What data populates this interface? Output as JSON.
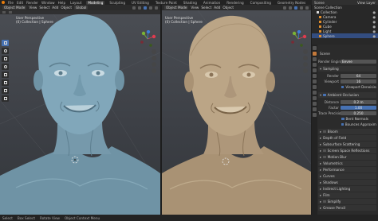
{
  "topbar": {
    "menus": [
      "File",
      "Edit",
      "Render",
      "Window",
      "Help"
    ],
    "tabs": [
      "Layout",
      "Modeling",
      "Sculpting",
      "UV Editing",
      "Texture Paint",
      "Shading",
      "Animation",
      "Rendering",
      "Compositing",
      "Geometry Nodes",
      "Scripting"
    ],
    "active_tab": "Modeling",
    "scene": "Scene",
    "view_layer": "View Layer"
  },
  "viewport_left": {
    "mode": "Object Mode",
    "menus": [
      "View",
      "Select",
      "Add",
      "Object"
    ],
    "orientation": "Global",
    "label_line1": "User Perspective",
    "label_line2": "(0) Collection | Sphere",
    "shading_color": "#7ea3b6"
  },
  "viewport_right": {
    "mode": "Object Mode",
    "menus": [
      "View",
      "Select",
      "Add",
      "Object"
    ],
    "label_line1": "User Perspective",
    "label_line2": "(0) Collection | Sphere",
    "shading_color": "#bda888"
  },
  "outliner": {
    "title": "Scene Collection",
    "items": [
      {
        "name": "Collection",
        "selected": false
      },
      {
        "name": "Camera",
        "selected": false
      },
      {
        "name": "Cylinder",
        "selected": false
      },
      {
        "name": "Cube",
        "selected": false
      },
      {
        "name": "Light",
        "selected": false
      },
      {
        "name": "Sphere",
        "selected": true
      }
    ]
  },
  "properties": {
    "scene_label": "Scene",
    "render_engine_label": "Render Engine",
    "render_engine": "Eevee",
    "sampling_title": "Sampling",
    "render_label": "Render",
    "render_value": "64",
    "viewport_label": "Viewport",
    "viewport_value": "16",
    "viewport_denoise": "Viewport Denoising",
    "ao_title": "Ambient Occlusion",
    "distance_label": "Distance",
    "distance_value": "0.2 m",
    "factor_label": "Factor",
    "factor_value": "1.00",
    "trace_label": "Trace Precision",
    "trace_value": "0.250",
    "bent_normals": "Bent Normals",
    "bounce_approx": "Bounces Approximation",
    "panels": [
      "Bloom",
      "Depth of Field",
      "Subsurface Scattering",
      "Screen Space Reflections",
      "Motion Blur",
      "Volumetrics",
      "Performance",
      "Curves",
      "Shadows",
      "Indirect Lighting",
      "Film",
      "Simplify",
      "Grease Pencil"
    ]
  },
  "statusbar": {
    "items": [
      "Select",
      "Box Select",
      "Rotate View",
      "Object Context Menu"
    ]
  }
}
